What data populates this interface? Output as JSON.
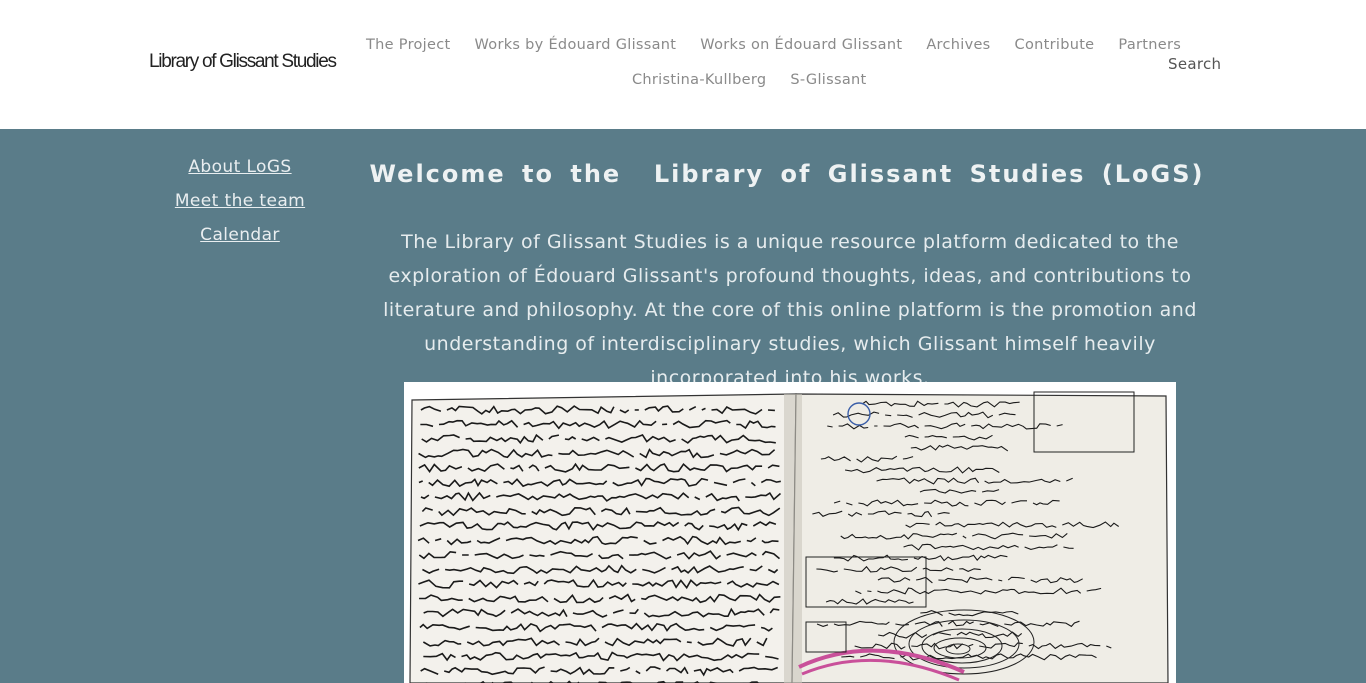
{
  "header": {
    "logo": "Library of Glissant Studies",
    "nav": [
      "The Project",
      "Works by Édouard Glissant",
      "Works on Édouard Glissant",
      "Archives",
      "Contribute",
      "Partners",
      "Christina-Kullberg",
      "S-Glissant"
    ],
    "search_label": "Search"
  },
  "sidebar": {
    "links": [
      "About LoGS",
      "Meet the team",
      "Calendar"
    ]
  },
  "main": {
    "title": "Welcome to the  Library of Glissant Studies (LoGS)",
    "intro": "The Library of Glissant Studies is a unique resource platform dedicated to the exploration of Édouard Glissant's profound thoughts, ideas, and contributions to literature and philosophy. At the core of this online platform is the promotion and understanding of interdisciplinary studies, which Glissant himself heavily incorporated into his works."
  },
  "colors": {
    "page_bg": "#5a7c89",
    "header_bg": "#ffffff",
    "nav_text": "#8a8a8a"
  }
}
